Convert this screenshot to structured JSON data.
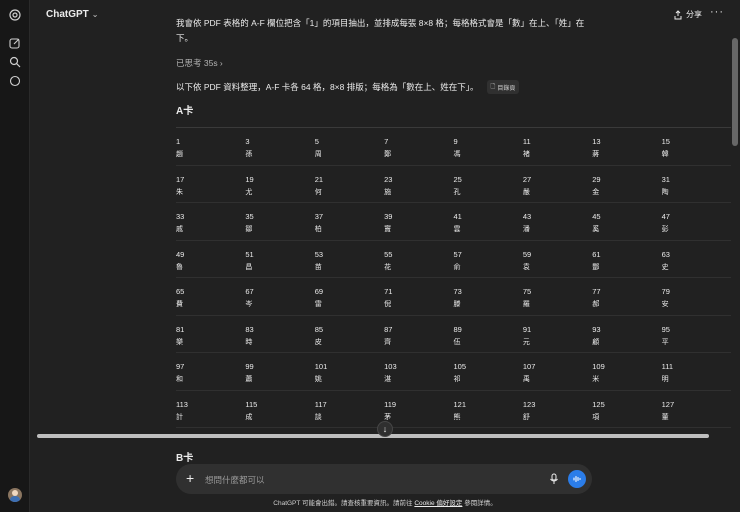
{
  "header": {
    "title": "ChatGPT",
    "share_label": "分享",
    "more_label": "···"
  },
  "message": {
    "intro": "我會依 PDF 表格的 A-F 欄位把含「1」的項目抽出，並排成每張 8×8 格；每格格式會是「數」在上、「姓」在下。",
    "thought": "已思考 35s ›",
    "summary": "以下依 PDF 資料整理，A-F 卡各 64 格，8×8 排版；每格為「數在上、姓在下」。",
    "source_chip": "目錄頁",
    "card_a_title": "A卡",
    "card_b_title": "B卡"
  },
  "table_a": {
    "rows": [
      [
        [
          "1",
          "趙"
        ],
        [
          "3",
          "孫"
        ],
        [
          "5",
          "周"
        ],
        [
          "7",
          "鄭"
        ],
        [
          "9",
          "馮"
        ],
        [
          "11",
          "褚"
        ],
        [
          "13",
          "蔣"
        ],
        [
          "15",
          "韓"
        ]
      ],
      [
        [
          "17",
          "朱"
        ],
        [
          "19",
          "尤"
        ],
        [
          "21",
          "何"
        ],
        [
          "23",
          "施"
        ],
        [
          "25",
          "孔"
        ],
        [
          "27",
          "嚴"
        ],
        [
          "29",
          "金"
        ],
        [
          "31",
          "陶"
        ]
      ],
      [
        [
          "33",
          "戚"
        ],
        [
          "35",
          "鄒"
        ],
        [
          "37",
          "柏"
        ],
        [
          "39",
          "竇"
        ],
        [
          "41",
          "雲"
        ],
        [
          "43",
          "潘"
        ],
        [
          "45",
          "奚"
        ],
        [
          "47",
          "彭"
        ]
      ],
      [
        [
          "49",
          "魯"
        ],
        [
          "51",
          "昌"
        ],
        [
          "53",
          "苗"
        ],
        [
          "55",
          "花"
        ],
        [
          "57",
          "俞"
        ],
        [
          "59",
          "袁"
        ],
        [
          "61",
          "酆"
        ],
        [
          "63",
          "史"
        ]
      ],
      [
        [
          "65",
          "費"
        ],
        [
          "67",
          "岑"
        ],
        [
          "69",
          "雷"
        ],
        [
          "71",
          "倪"
        ],
        [
          "73",
          "滕"
        ],
        [
          "75",
          "羅"
        ],
        [
          "77",
          "郝"
        ],
        [
          "79",
          "安"
        ]
      ],
      [
        [
          "81",
          "樂"
        ],
        [
          "83",
          "時"
        ],
        [
          "85",
          "皮"
        ],
        [
          "87",
          "齊"
        ],
        [
          "89",
          "伍"
        ],
        [
          "91",
          "元"
        ],
        [
          "93",
          "顧"
        ],
        [
          "95",
          "平"
        ]
      ],
      [
        [
          "97",
          "和"
        ],
        [
          "99",
          "蕭"
        ],
        [
          "101",
          "姚"
        ],
        [
          "103",
          "湛"
        ],
        [
          "105",
          "祁"
        ],
        [
          "107",
          "禹"
        ],
        [
          "109",
          "米"
        ],
        [
          "111",
          "明"
        ]
      ],
      [
        [
          "113",
          "計"
        ],
        [
          "115",
          "成"
        ],
        [
          "117",
          "談"
        ],
        [
          "119",
          "茅"
        ],
        [
          "121",
          "熊"
        ],
        [
          "123",
          "舒"
        ],
        [
          "125",
          "項"
        ],
        [
          "127",
          "董"
        ]
      ]
    ]
  },
  "composer": {
    "placeholder": "想問什麼都可以"
  },
  "footer": {
    "text_before": "ChatGPT 可能會出錯。請查核重要資訊。請前往",
    "link": "Cookie 偏好設定",
    "text_after": "參閱詳情。"
  },
  "colors": {
    "background": "#212121",
    "sidebar": "#171717",
    "composer": "#303030",
    "accent": "#2b7de9"
  }
}
